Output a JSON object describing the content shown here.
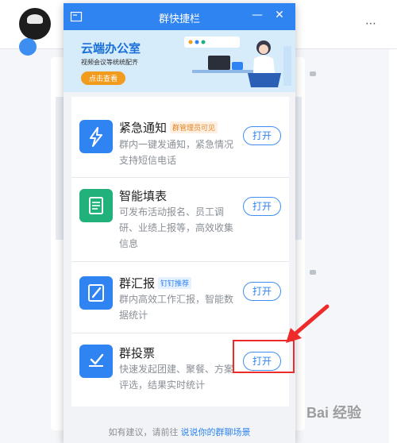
{
  "popup": {
    "title": "群快捷栏",
    "minimize_glyph": "—",
    "close_glyph": "✕"
  },
  "banner": {
    "title": "云端办公室",
    "subtitle": "视频会议等统统配齐",
    "button": "点击查看"
  },
  "items": [
    {
      "title": "紧急通知",
      "badge": "群管理员可见",
      "desc": "群内一键发通知，紧急情况支持短信电话",
      "button": "打开",
      "icon": "lightning-icon",
      "color": "#2f84f2"
    },
    {
      "title": "智能填表",
      "badge": "",
      "desc": "可发布活动报名、员工调研、业绩上报等，高效收集信息",
      "button": "打开",
      "icon": "form-icon",
      "color": "#20b27a"
    },
    {
      "title": "群汇报",
      "badge": "钉钉推荐",
      "desc": "群内高效工作汇报，智能数据统计",
      "button": "打开",
      "icon": "report-icon",
      "color": "#2f84f2"
    },
    {
      "title": "群投票",
      "badge": "",
      "desc": "快速发起团建、聚餐、方案评选，结果实时统计",
      "button": "打开",
      "icon": "vote-icon",
      "color": "#2f84f2"
    }
  ],
  "footer": {
    "prefix": "如有建议，请前往",
    "link": "说说你的群聊场景"
  },
  "watermark": "Bai 经验",
  "colors": {
    "accent": "#2f84f2",
    "annotation": "#ee2b2b"
  }
}
